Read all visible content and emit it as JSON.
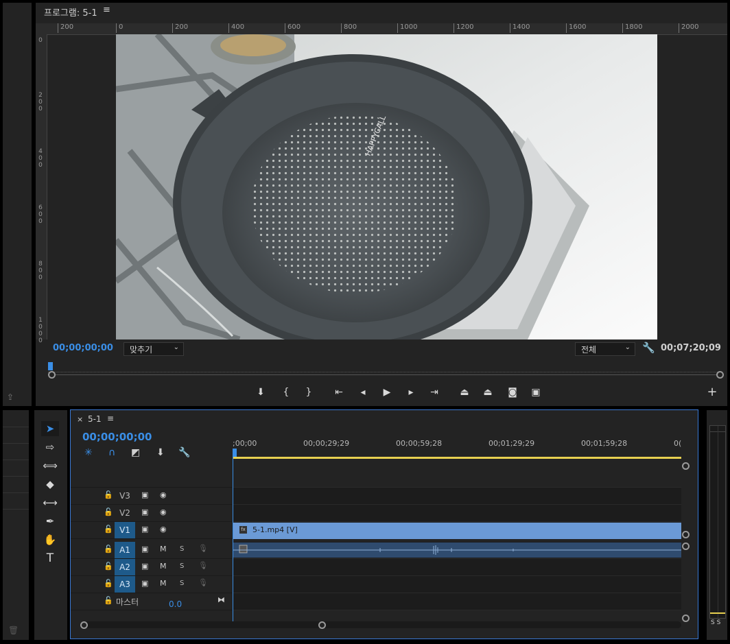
{
  "program": {
    "title": "프로그램: 5-1",
    "menu_icon": "≡",
    "ruler_h": [
      "200",
      "0",
      "200",
      "400",
      "600",
      "800",
      "1000",
      "1200",
      "1400",
      "1600",
      "1800",
      "2000"
    ],
    "ruler_v": [
      "0",
      "200",
      "400",
      "600",
      "800",
      "1000"
    ],
    "current_tc": "00;00;00;00",
    "fit_label": "맞추기",
    "resolution_label": "전체",
    "duration_tc": "00;07;20;09",
    "add_label": "+"
  },
  "transport": [
    {
      "name": "add-marker-button",
      "icon": "⬇"
    },
    {
      "name": "mark-in-button",
      "icon": "{"
    },
    {
      "name": "mark-out-button",
      "icon": "}"
    },
    {
      "name": "go-to-in-button",
      "icon": "|←"
    },
    {
      "name": "step-back-button",
      "icon": "◀|"
    },
    {
      "name": "play-button",
      "icon": "▶"
    },
    {
      "name": "step-forward-button",
      "icon": "|▶"
    },
    {
      "name": "go-to-out-button",
      "icon": "→|"
    },
    {
      "name": "lift-button",
      "icon": "⏏"
    },
    {
      "name": "extract-button",
      "icon": "⏏"
    },
    {
      "name": "export-frame-button",
      "icon": "📷"
    },
    {
      "name": "compare-button",
      "icon": "▣"
    }
  ],
  "tools": [
    {
      "name": "selection-tool",
      "icon": "➤"
    },
    {
      "name": "track-select-tool",
      "icon": "⇥"
    },
    {
      "name": "ripple-edit-tool",
      "icon": "↔"
    },
    {
      "name": "razor-tool",
      "icon": "◆"
    },
    {
      "name": "slip-tool",
      "icon": "⟷"
    },
    {
      "name": "pen-tool",
      "icon": "✒"
    },
    {
      "name": "hand-tool",
      "icon": "✋"
    },
    {
      "name": "type-tool",
      "icon": "T"
    }
  ],
  "timeline": {
    "close": "×",
    "sequence_name": "5-1",
    "menu_icon": "≡",
    "current_tc": "00;00;00;00",
    "ruler_labels": [
      ";00;00",
      "00;00;29;29",
      "00;00;59;28",
      "00;01;29;29",
      "00;01;59;28",
      "0("
    ],
    "video_tracks": [
      {
        "name": "V3",
        "on": false
      },
      {
        "name": "V2",
        "on": false
      },
      {
        "name": "V1",
        "on": true
      }
    ],
    "audio_tracks": [
      {
        "name": "A1",
        "m": "M",
        "s": "S"
      },
      {
        "name": "A2",
        "m": "M",
        "s": "S"
      },
      {
        "name": "A3",
        "m": "M",
        "s": "S"
      }
    ],
    "master_label": "마스터",
    "master_value": "0.0",
    "video_clip": "5-1.mp4 [V]",
    "clip_badge": "fx"
  },
  "meter": {
    "solo_labels": "S S"
  },
  "colors": {
    "accent": "#3a8ee6",
    "track_on": "#1e5a8a",
    "clip_video": "#6b9ad6",
    "work_area": "#e8d050"
  }
}
